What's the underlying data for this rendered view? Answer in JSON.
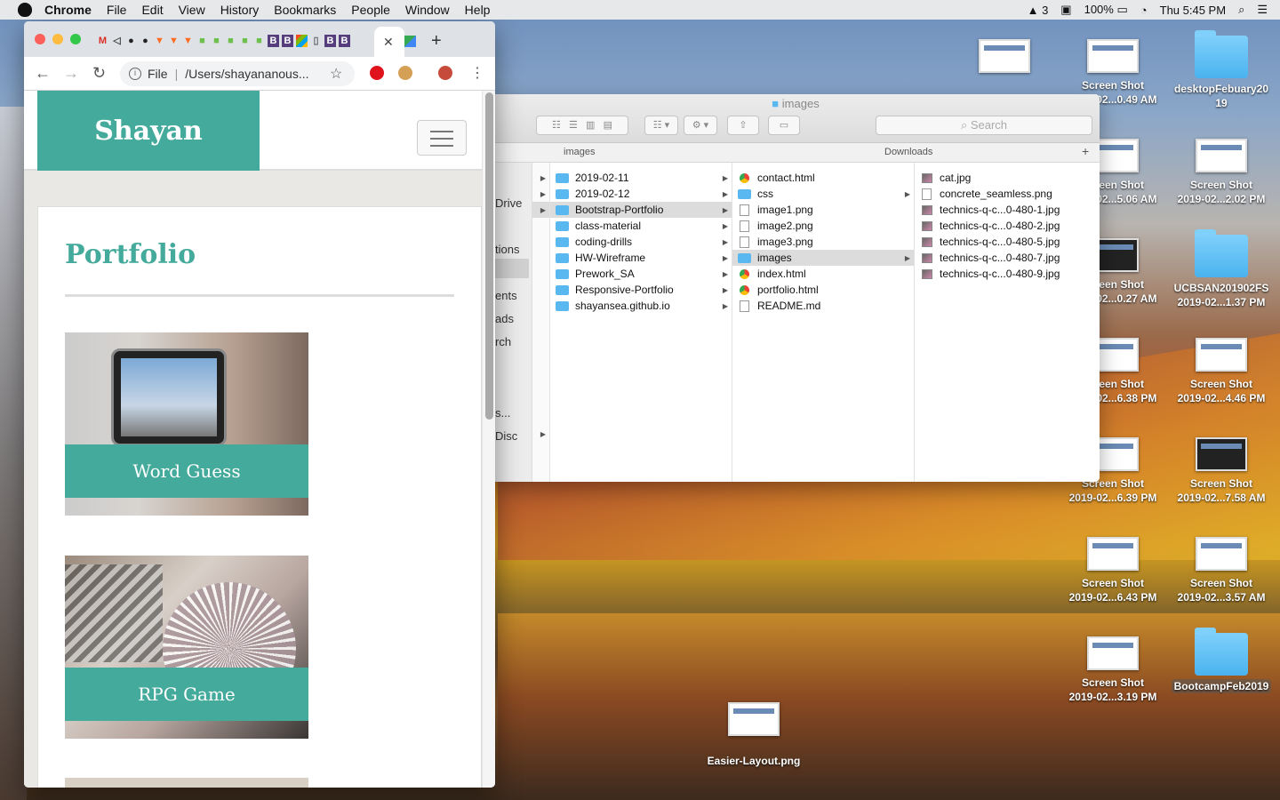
{
  "menubar": {
    "app": "Chrome",
    "items": [
      "File",
      "Edit",
      "View",
      "History",
      "Bookmarks",
      "People",
      "Window",
      "Help"
    ],
    "status_adobe": "3",
    "battery": "100%",
    "clock": "Thu 5:45 PM"
  },
  "browser": {
    "omnibox_scheme": "File",
    "omnibox_path": "/Users/shayananous..."
  },
  "page": {
    "brand": "Shayan",
    "section_title": "Portfolio",
    "projects": [
      {
        "caption": "Word Guess"
      },
      {
        "caption": "RPG Game"
      }
    ]
  },
  "finder": {
    "title": "images",
    "search_placeholder": "Search",
    "header_left": "images",
    "header_right": "Downloads",
    "sidebar": [
      "Drive",
      "tions",
      "ents",
      "ads",
      "rch",
      "s...",
      "Disc"
    ],
    "col1": [
      "2019-02-11",
      "2019-02-12",
      "Bootstrap-Portfolio",
      "class-material",
      "coding-drills",
      "HW-Wireframe",
      "Prework_SA",
      "Responsive-Portfolio",
      "shayansea.github.io"
    ],
    "col2": [
      "contact.html",
      "css",
      "image1.png",
      "image2.png",
      "image3.png",
      "images",
      "index.html",
      "portfolio.html",
      "README.md"
    ],
    "col3": [
      "cat.jpg",
      "concrete_seamless.png",
      "technics-q-c...0-480-1.jpg",
      "technics-q-c...0-480-2.jpg",
      "technics-q-c...0-480-5.jpg",
      "technics-q-c...0-480-7.jpg",
      "technics-q-c...0-480-9.jpg"
    ]
  },
  "desktop": {
    "icons": [
      {
        "l1": "Screen Shot",
        "l2": "2019-02...0.49 AM"
      },
      {
        "l1": "desktopFebuary20",
        "l2": "19"
      },
      {
        "l1": "Screen Shot",
        "l2": "2019-02...5.06 AM"
      },
      {
        "l1": "Screen Shot",
        "l2": "2019-02...2.02 PM"
      },
      {
        "l1": "Screen Shot",
        "l2": "2019-02...0.27 AM"
      },
      {
        "l1": "UCBSAN201902FS",
        "l2": "2019-02...1.37 PM"
      },
      {
        "l1": "Screen Shot",
        "l2": "2019-02...6.38 PM"
      },
      {
        "l1": "Screen Shot",
        "l2": "2019-02...4.46 PM"
      },
      {
        "l1": "Screen Shot",
        "l2": "2019-02...6.39 PM"
      },
      {
        "l1": "Screen Shot",
        "l2": "2019-02...7.58 AM"
      },
      {
        "l1": "Screen Shot",
        "l2": "2019-02...6.43 PM"
      },
      {
        "l1": "Screen Shot",
        "l2": "2019-02...3.57 AM"
      },
      {
        "l1": "Screen Shot",
        "l2": "2019-02...3.19 PM"
      },
      {
        "l1": "BootcampFeb2019",
        "l2": ""
      },
      {
        "l1": "Easier-Layout.png",
        "l2": ""
      }
    ]
  },
  "colors": {
    "accent": "#44aa9b",
    "finder_folder": "#5ab8f0"
  }
}
